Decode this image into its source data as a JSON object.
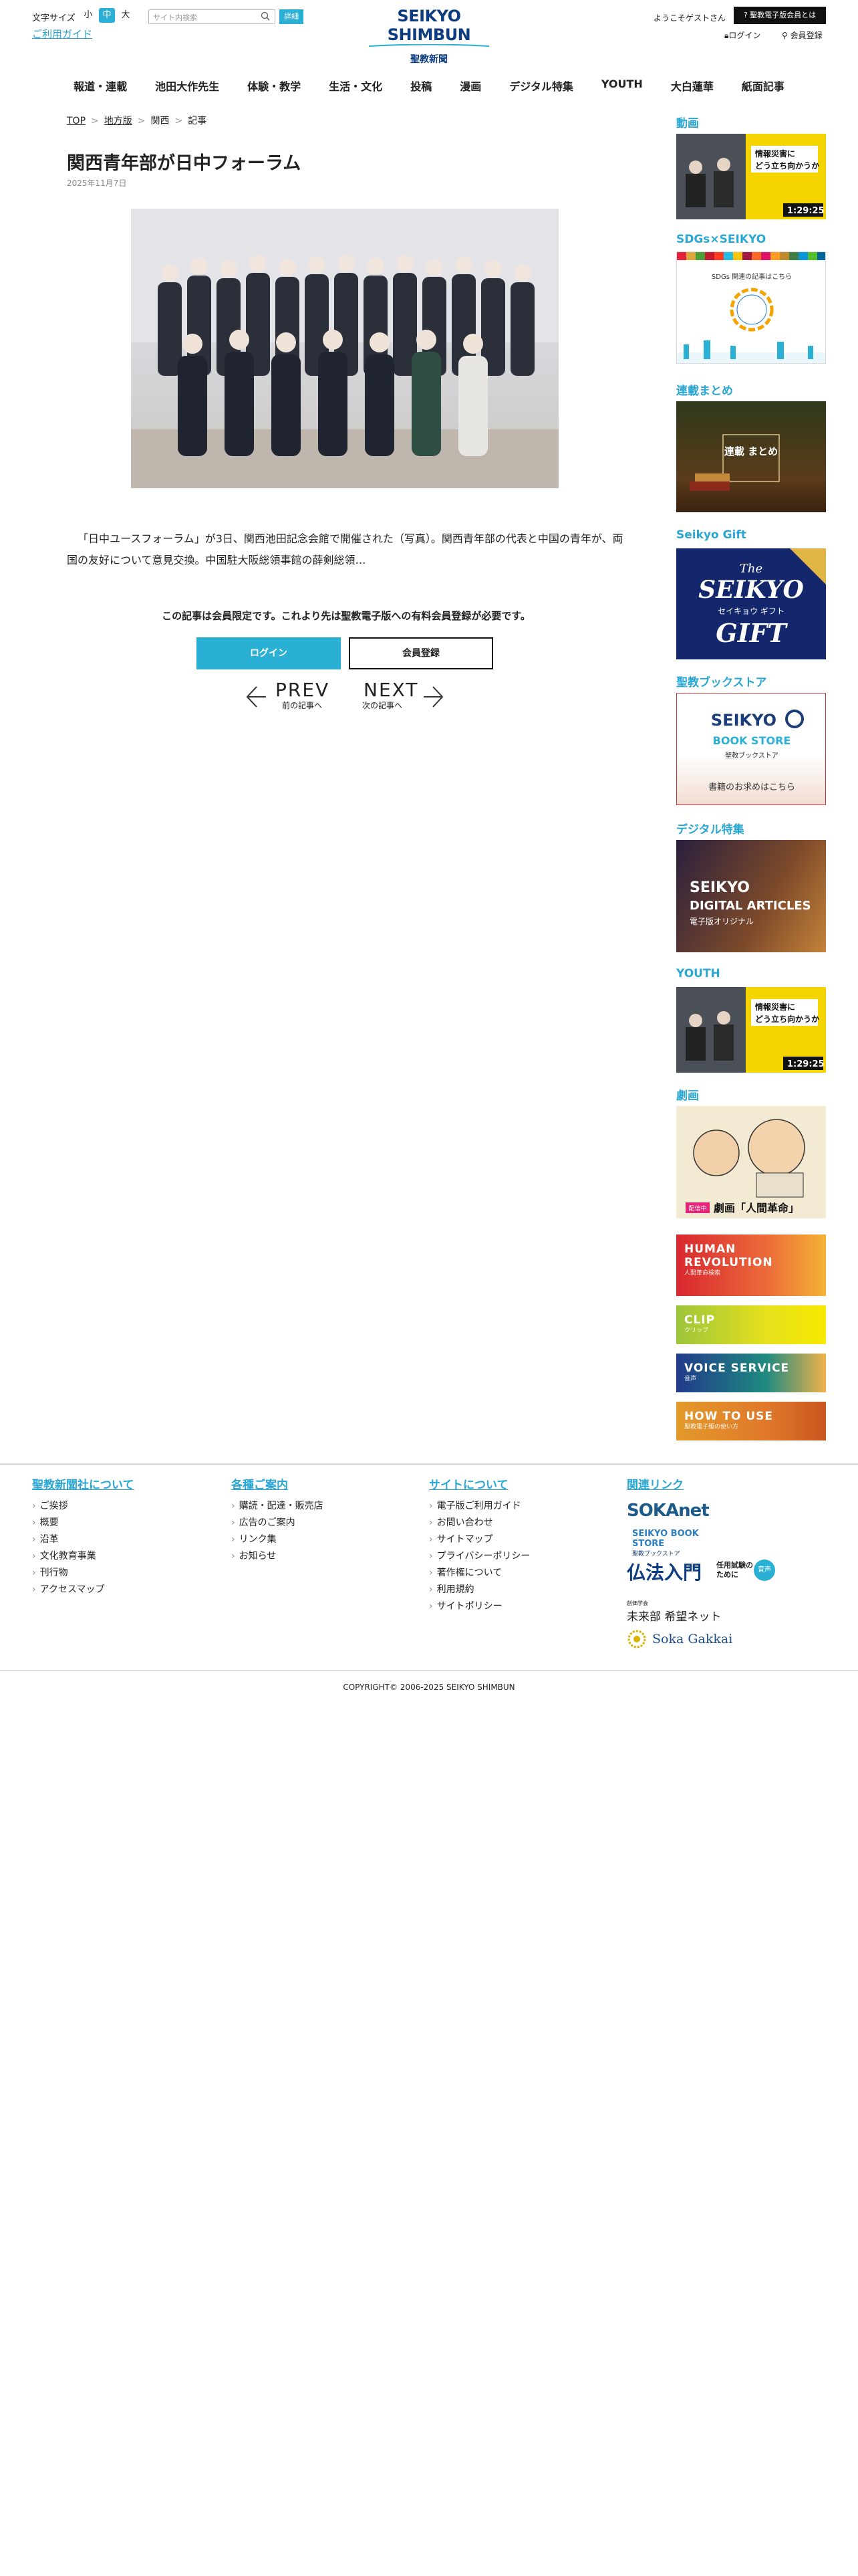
{
  "header": {
    "font_size_label": "文字サイズ",
    "font_sizes": [
      "小",
      "中",
      "大"
    ],
    "guide_link": "ご利用ガイド",
    "search_placeholder": "サイト内検索",
    "search_detail": "詳細",
    "logo_main": "SEIKYO SHIMBUN",
    "logo_sub": "聖教新聞",
    "welcome": "ようこそゲストさん",
    "about_button": "聖教電子版会員とは",
    "login": "ログイン",
    "register": "会員登録"
  },
  "nav": [
    "報道・連載",
    "池田大作先生",
    "体験・教学",
    "生活・文化",
    "投稿",
    "漫画",
    "デジタル特集",
    "YOUTH",
    "大白蓮華",
    "紙面記事"
  ],
  "breadcrumb": [
    "TOP",
    "地方版",
    "関西",
    "記事"
  ],
  "article": {
    "title": "関西青年部が日中フォーラム",
    "date": "2025年11月7日",
    "lead": "「日中ユースフォーラム」が3日、関西池田記念会館で開催された（写真）。関西青年部の代表と中国の青年が、両国の友好について意見交換。中国駐大阪総領事館の薛剣総領…",
    "member_note": "この記事は会員限定です。これより先は聖教電子版への有料会員登録が必要です。",
    "login_button": "ログイン",
    "signup_button": "会員登録",
    "prev": "PREV",
    "prev_sub": "前の記事へ",
    "next": "NEXT",
    "next_sub": "次の記事へ"
  },
  "sidebar": {
    "video_heading": "動画",
    "video_caption_1": "情報災害に",
    "video_caption_2": "どう立ち向かうか",
    "video_time": "1:29:25",
    "sdgs_heading": "SDGs×SEIKYO",
    "sdgs_text": "SDGs 関連の記事はこちら",
    "matome_heading": "連載まとめ",
    "matome_text": "連載\nまとめ",
    "gift_heading": "Seikyo Gift",
    "gift_the": "The",
    "gift_seikyo": "SEIKYO",
    "gift_kana": "セイキョウ ギフト",
    "gift_word": "GIFT",
    "bookstore_heading": "聖教ブックストア",
    "bookstore_title_1": "SEIKYO",
    "bookstore_title_2": "BOOK STORE",
    "bookstore_sub": "聖教ブックストア",
    "bookstore_cta": "書籍のお求めはこちら",
    "digital_heading": "デジタル特集",
    "digital_1": "SEIKYO",
    "digital_2": "DIGITAL ARTICLES",
    "digital_3": "電子版オリジナル",
    "youth_heading": "YOUTH",
    "manga_heading": "劇画",
    "manga_badge": "配信中",
    "manga_title": "劇画「人間革命」",
    "banners": [
      {
        "title": "HUMAN REVOLUTION",
        "sub": "人間革命検索"
      },
      {
        "title": "CLIP",
        "sub": "クリップ"
      },
      {
        "title": "VOICE SERVICE",
        "sub": "音声"
      },
      {
        "title": "HOW TO USE",
        "sub": "聖教電子版の使い方"
      }
    ]
  },
  "footer": {
    "col1_heading": "聖教新聞社について",
    "col1": [
      "ご挨拶",
      "概要",
      "沿革",
      "文化教育事業",
      "刊行物",
      "アクセスマップ"
    ],
    "col2_heading": "各種ご案内",
    "col2": [
      "購読・配達・販売店",
      "広告のご案内",
      "リンク集",
      "お知らせ"
    ],
    "col3_heading": "サイトについて",
    "col3": [
      "電子版ご利用ガイド",
      "お問い合わせ",
      "サイトマップ",
      "プライバシーポリシー",
      "著作権について",
      "利用規約",
      "サイトポリシー"
    ],
    "col4_heading": "関連リンク",
    "links": {
      "sokanet": "SOKAnet",
      "bookstore": "SEIKYO BOOK STORE",
      "bookstore_sub": "聖教ブックストア",
      "buppo": "仏法入門",
      "buppo_sub": "任用試験のために",
      "buppo_badge": "音声",
      "mirai": "未来部 希望ネット",
      "mirai_sub": "創価学会",
      "gakkai": "Soka Gakkai"
    },
    "copyright": "COPYRIGHT© 2006-2025 SEIKYO SHIMBUN"
  },
  "colors": {
    "accent": "#2ab0d4",
    "brand_navy": "#0d3d80"
  }
}
